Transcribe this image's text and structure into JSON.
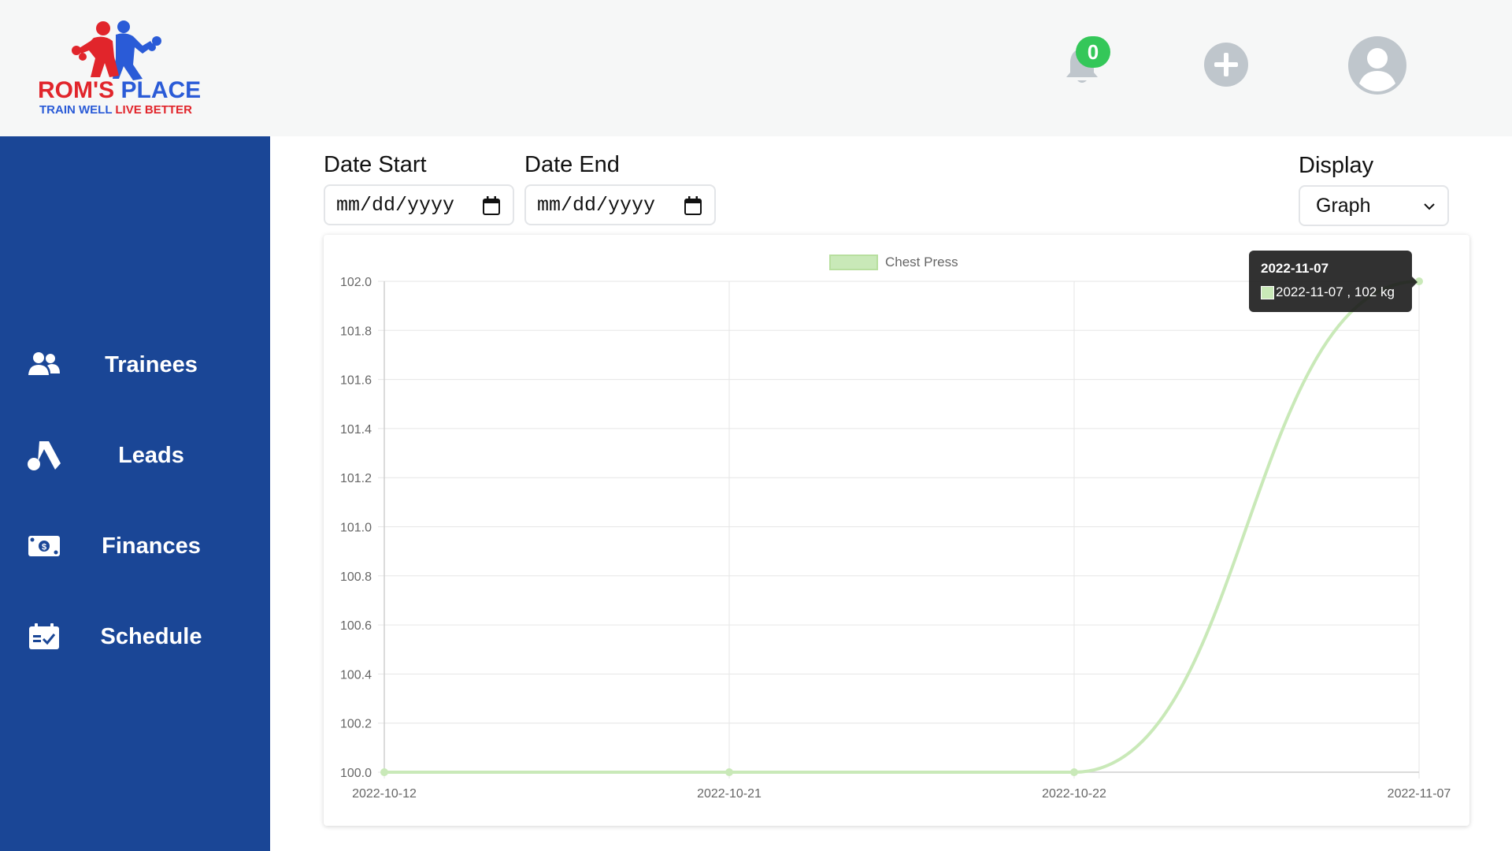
{
  "brand": {
    "name_part1": "ROM'S",
    "name_part2": "PLACE",
    "tagline_part1": "TRAIN WELL",
    "tagline_part2": "LIVE BETTER"
  },
  "header": {
    "notifications_count": "0",
    "icons": [
      "bell-icon",
      "plus-circle-icon",
      "user-avatar-icon"
    ]
  },
  "sidebar": {
    "items": [
      {
        "label": "Trainees",
        "icon": "users-icon"
      },
      {
        "label": "Leads",
        "icon": "leads-icon"
      },
      {
        "label": "Finances",
        "icon": "money-icon"
      },
      {
        "label": "Schedule",
        "icon": "calendar-check-icon"
      }
    ]
  },
  "filters": {
    "date_start_label": "Date Start",
    "date_start_value": "mm/dd/yyyy",
    "date_end_label": "Date End",
    "date_end_value": "mm/dd/yyyy",
    "display_label": "Display",
    "display_value": "Graph"
  },
  "colors": {
    "sidebar_bg": "#1a4696",
    "series_line": "#c9e9b8",
    "badge": "#34c759"
  },
  "tooltip": {
    "title": "2022-11-07",
    "text": "2022-11-07 , 102 kg"
  },
  "chart_data": {
    "type": "line",
    "categories": [
      "2022-10-12",
      "2022-10-21",
      "2022-10-22",
      "2022-11-07"
    ],
    "series": [
      {
        "name": "Chest Press",
        "values": [
          100.0,
          100.0,
          100.0,
          102.0
        ]
      }
    ],
    "ylim": [
      100.0,
      102.0
    ],
    "yticks": [
      "102.0",
      "101.8",
      "101.6",
      "101.4",
      "101.2",
      "101.0",
      "100.8",
      "100.6",
      "100.4",
      "100.2",
      "100.0"
    ],
    "grid": true,
    "legend": "top"
  }
}
